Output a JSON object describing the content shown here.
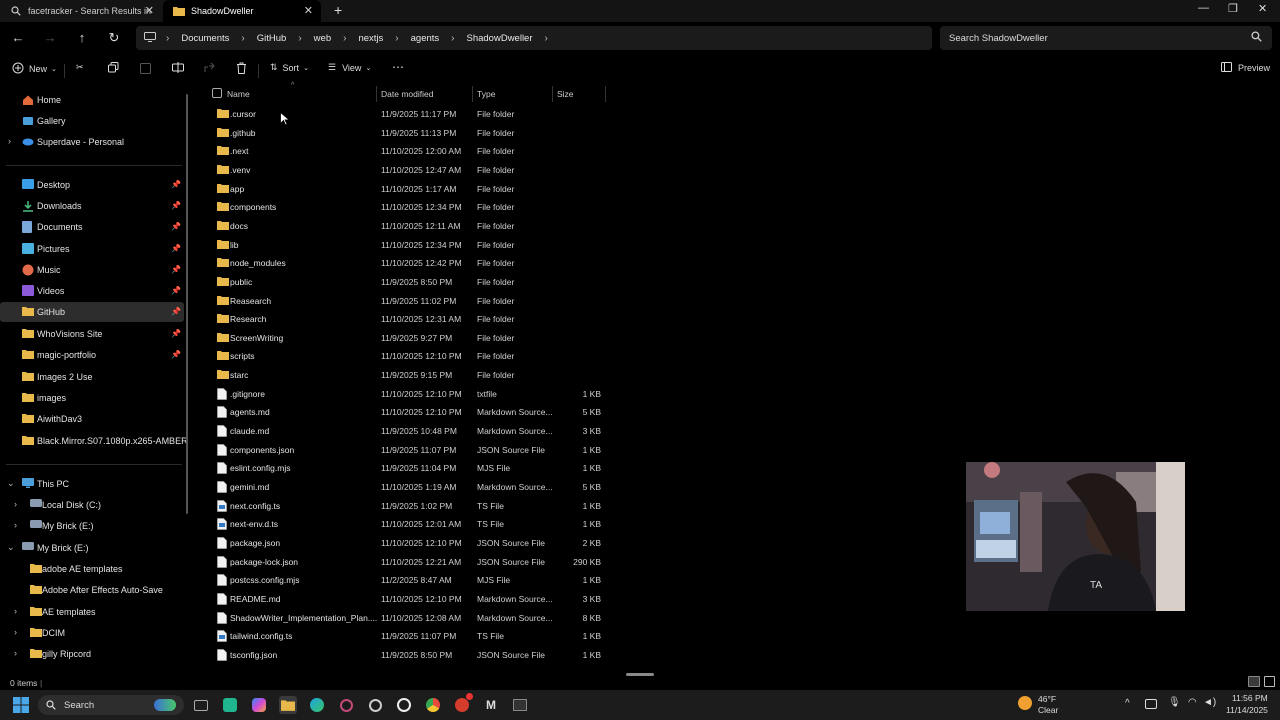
{
  "tabs": [
    {
      "label": "facetracker - Search Results in",
      "icon": "search-icon"
    },
    {
      "label": "ShadowDweller",
      "icon": "folder-icon"
    }
  ],
  "breadcrumb": [
    "Documents",
    "GitHub",
    "web",
    "nextjs",
    "agents",
    "ShadowDweller"
  ],
  "search": {
    "placeholder": "Search ShadowDweller"
  },
  "toolbar": {
    "new_label": "New",
    "sort_label": "Sort",
    "view_label": "View",
    "preview_label": "Preview"
  },
  "sidebar": {
    "top": [
      {
        "label": "Home",
        "icon": "home-icon"
      },
      {
        "label": "Gallery",
        "icon": "gallery-icon"
      },
      {
        "label": "Superdave - Personal",
        "icon": "cloud-icon"
      }
    ],
    "quick": [
      {
        "label": "Desktop",
        "icon": "desktop-icon"
      },
      {
        "label": "Downloads",
        "icon": "downloads-icon"
      },
      {
        "label": "Documents",
        "icon": "documents-icon"
      },
      {
        "label": "Pictures",
        "icon": "pictures-icon"
      },
      {
        "label": "Music",
        "icon": "music-icon"
      },
      {
        "label": "Videos",
        "icon": "videos-icon"
      },
      {
        "label": "GitHub",
        "icon": "folder-icon"
      },
      {
        "label": "WhoVisions Site",
        "icon": "folder-icon"
      },
      {
        "label": "magic-portfolio",
        "icon": "folder-icon"
      },
      {
        "label": "Images 2 Use",
        "icon": "folder-icon"
      },
      {
        "label": "images",
        "icon": "folder-icon"
      },
      {
        "label": "AiwithDav3",
        "icon": "folder-icon"
      },
      {
        "label": "Black.Mirror.S07.1080p.x265-AMBER",
        "icon": "folder-icon"
      }
    ],
    "tree": [
      {
        "label": "This PC",
        "icon": "pc-icon"
      },
      {
        "label": "Local Disk (C:)",
        "icon": "drive-icon"
      },
      {
        "label": "My Brick  (E:)",
        "icon": "drive-icon"
      },
      {
        "label": "My Brick  (E:)",
        "icon": "drive-icon"
      },
      {
        "label": "adobe AE templates",
        "icon": "folder-icon"
      },
      {
        "label": "Adobe After Effects Auto-Save",
        "icon": "folder-icon"
      },
      {
        "label": "AE templates",
        "icon": "folder-icon"
      },
      {
        "label": "DCIM",
        "icon": "folder-icon"
      },
      {
        "label": "gilly Ripcord",
        "icon": "folder-icon"
      }
    ]
  },
  "columns": {
    "name": "Name",
    "date": "Date modified",
    "type": "Type",
    "size": "Size"
  },
  "files": [
    {
      "name": ".cursor",
      "date": "11/9/2025 11:17 PM",
      "type": "File folder",
      "size": "",
      "kind": "folder"
    },
    {
      "name": ".github",
      "date": "11/9/2025 11:13 PM",
      "type": "File folder",
      "size": "",
      "kind": "folder"
    },
    {
      "name": ".next",
      "date": "11/10/2025 12:00 AM",
      "type": "File folder",
      "size": "",
      "kind": "folder"
    },
    {
      "name": ".venv",
      "date": "11/10/2025 12:47 AM",
      "type": "File folder",
      "size": "",
      "kind": "folder"
    },
    {
      "name": "app",
      "date": "11/10/2025 1:17 AM",
      "type": "File folder",
      "size": "",
      "kind": "folder"
    },
    {
      "name": "components",
      "date": "11/10/2025 12:34 PM",
      "type": "File folder",
      "size": "",
      "kind": "folder"
    },
    {
      "name": "docs",
      "date": "11/10/2025 12:11 AM",
      "type": "File folder",
      "size": "",
      "kind": "folder"
    },
    {
      "name": "lib",
      "date": "11/10/2025 12:34 PM",
      "type": "File folder",
      "size": "",
      "kind": "folder"
    },
    {
      "name": "node_modules",
      "date": "11/10/2025 12:42 PM",
      "type": "File folder",
      "size": "",
      "kind": "folder"
    },
    {
      "name": "public",
      "date": "11/9/2025 8:50 PM",
      "type": "File folder",
      "size": "",
      "kind": "folder"
    },
    {
      "name": "Reasearch",
      "date": "11/9/2025 11:02 PM",
      "type": "File folder",
      "size": "",
      "kind": "folder"
    },
    {
      "name": "Research",
      "date": "11/10/2025 12:31 AM",
      "type": "File folder",
      "size": "",
      "kind": "folder"
    },
    {
      "name": "ScreenWriting",
      "date": "11/9/2025 9:27 PM",
      "type": "File folder",
      "size": "",
      "kind": "folder"
    },
    {
      "name": "scripts",
      "date": "11/10/2025 12:10 PM",
      "type": "File folder",
      "size": "",
      "kind": "folder"
    },
    {
      "name": "starc",
      "date": "11/9/2025 9:15 PM",
      "type": "File folder",
      "size": "",
      "kind": "folder"
    },
    {
      "name": ".gitignore",
      "date": "11/10/2025 12:10 PM",
      "type": "txtfile",
      "size": "1 KB",
      "kind": "file"
    },
    {
      "name": "agents.md",
      "date": "11/10/2025 12:10 PM",
      "type": "Markdown Source...",
      "size": "5 KB",
      "kind": "file"
    },
    {
      "name": "claude.md",
      "date": "11/9/2025 10:48 PM",
      "type": "Markdown Source...",
      "size": "3 KB",
      "kind": "file"
    },
    {
      "name": "components.json",
      "date": "11/9/2025 11:07 PM",
      "type": "JSON Source File",
      "size": "1 KB",
      "kind": "file"
    },
    {
      "name": "eslint.config.mjs",
      "date": "11/9/2025 11:04 PM",
      "type": "MJS File",
      "size": "1 KB",
      "kind": "file"
    },
    {
      "name": "gemini.md",
      "date": "11/10/2025 1:19 AM",
      "type": "Markdown Source...",
      "size": "5 KB",
      "kind": "file"
    },
    {
      "name": "next.config.ts",
      "date": "11/9/2025 1:02 PM",
      "type": "TS File",
      "size": "1 KB",
      "kind": "ts"
    },
    {
      "name": "next-env.d.ts",
      "date": "11/10/2025 12:01 AM",
      "type": "TS File",
      "size": "1 KB",
      "kind": "ts"
    },
    {
      "name": "package.json",
      "date": "11/10/2025 12:10 PM",
      "type": "JSON Source File",
      "size": "2 KB",
      "kind": "file"
    },
    {
      "name": "package-lock.json",
      "date": "11/10/2025 12:21 AM",
      "type": "JSON Source File",
      "size": "290 KB",
      "kind": "file"
    },
    {
      "name": "postcss.config.mjs",
      "date": "11/2/2025 8:47 AM",
      "type": "MJS File",
      "size": "1 KB",
      "kind": "file"
    },
    {
      "name": "README.md",
      "date": "11/10/2025 12:10 PM",
      "type": "Markdown Source...",
      "size": "3 KB",
      "kind": "file"
    },
    {
      "name": "ShadowWriter_Implementation_Plan....",
      "date": "11/10/2025 12:08 AM",
      "type": "Markdown Source...",
      "size": "8 KB",
      "kind": "file"
    },
    {
      "name": "tailwind.config.ts",
      "date": "11/9/2025 11:07 PM",
      "type": "TS File",
      "size": "1 KB",
      "kind": "ts"
    },
    {
      "name": "tsconfig.json",
      "date": "11/9/2025 8:50 PM",
      "type": "JSON Source File",
      "size": "1 KB",
      "kind": "file"
    }
  ],
  "status": {
    "items": "0 items"
  },
  "taskbar": {
    "search_label": "Search",
    "weather_temp": "46°F",
    "weather_cond": "Clear",
    "time": "11:56 PM",
    "date": "11/14/2025"
  },
  "colors": {
    "folder": "#e8b84a",
    "accent": "#4a9eda"
  }
}
